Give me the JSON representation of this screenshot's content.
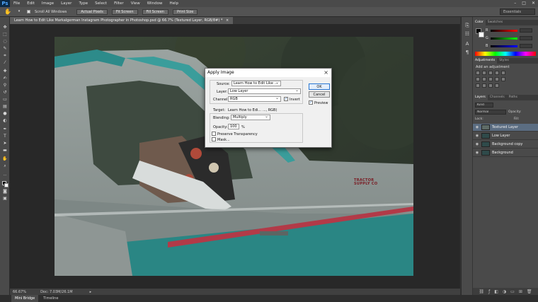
{
  "app": {
    "logo": "Ps",
    "menu": [
      "File",
      "Edit",
      "Image",
      "Layer",
      "Type",
      "Select",
      "Filter",
      "View",
      "Window",
      "Help"
    ],
    "window_controls": [
      "–",
      "□",
      "✕"
    ]
  },
  "options_bar": {
    "scroll_all_windows": "Scroll All Windows",
    "buttons": [
      "Actual Pixels",
      "Fit Screen",
      "Fill Screen",
      "Print Size"
    ],
    "workspace": "Essentials"
  },
  "document_tab": {
    "title": "Learn How to Edit Like Markalgerman Instagram Photographer in Photoshop.psd @ 66.7% (Textured Layer, RGB/8#) *",
    "close": "×"
  },
  "status_bar": {
    "zoom": "66.67%",
    "doc_info": "Doc: 7.03M/26.1M"
  },
  "bottom_tabs": [
    "Mini Bridge",
    "Timeline"
  ],
  "right_panels": {
    "color_tabs": [
      "Color",
      "Swatches"
    ],
    "color_sliders": [
      {
        "letter": "R",
        "color": "#e03a3a"
      },
      {
        "letter": "G",
        "color": "#3ac03a"
      },
      {
        "letter": "B",
        "color": "#3a60e0"
      }
    ],
    "adjustments_tabs": [
      "Adjustments",
      "Styles"
    ],
    "adjustments_title": "Add an adjustment",
    "layers_tabs": [
      "Layers",
      "Channels",
      "Paths"
    ],
    "kind": "Kind",
    "blend_mode": "Normal",
    "opacity_label": "Opacity:",
    "lock_label": "Lock:",
    "fill_label": "Fill:",
    "layers": [
      {
        "name": "Textured Layer",
        "selected": true
      },
      {
        "name": "Low Layer",
        "selected": false
      },
      {
        "name": "Background copy",
        "selected": false
      },
      {
        "name": "Background",
        "selected": false
      }
    ]
  },
  "dialog": {
    "title": "Apply Image",
    "source_label": "Source:",
    "source_value": "Learn How to Edit Like ...",
    "layer_label": "Layer:",
    "layer_value": "Low Layer",
    "channel_label": "Channel:",
    "channel_value": "RGB",
    "invert_label": "Invert",
    "target_label": "Target:",
    "target_value": "Learn How to Edi... ..., RGB)",
    "blending_label": "Blending:",
    "blending_value": "Multiply",
    "opacity_label": "Opacity:",
    "opacity_value": "100",
    "opacity_unit": "%",
    "preserve_transparency": "Preserve Transparency",
    "mask": "Mask...",
    "ok": "OK",
    "cancel": "Cancel",
    "preview": "Preview"
  },
  "photo": {
    "truck_badge": "TRACTOR SUPPLY CO"
  }
}
